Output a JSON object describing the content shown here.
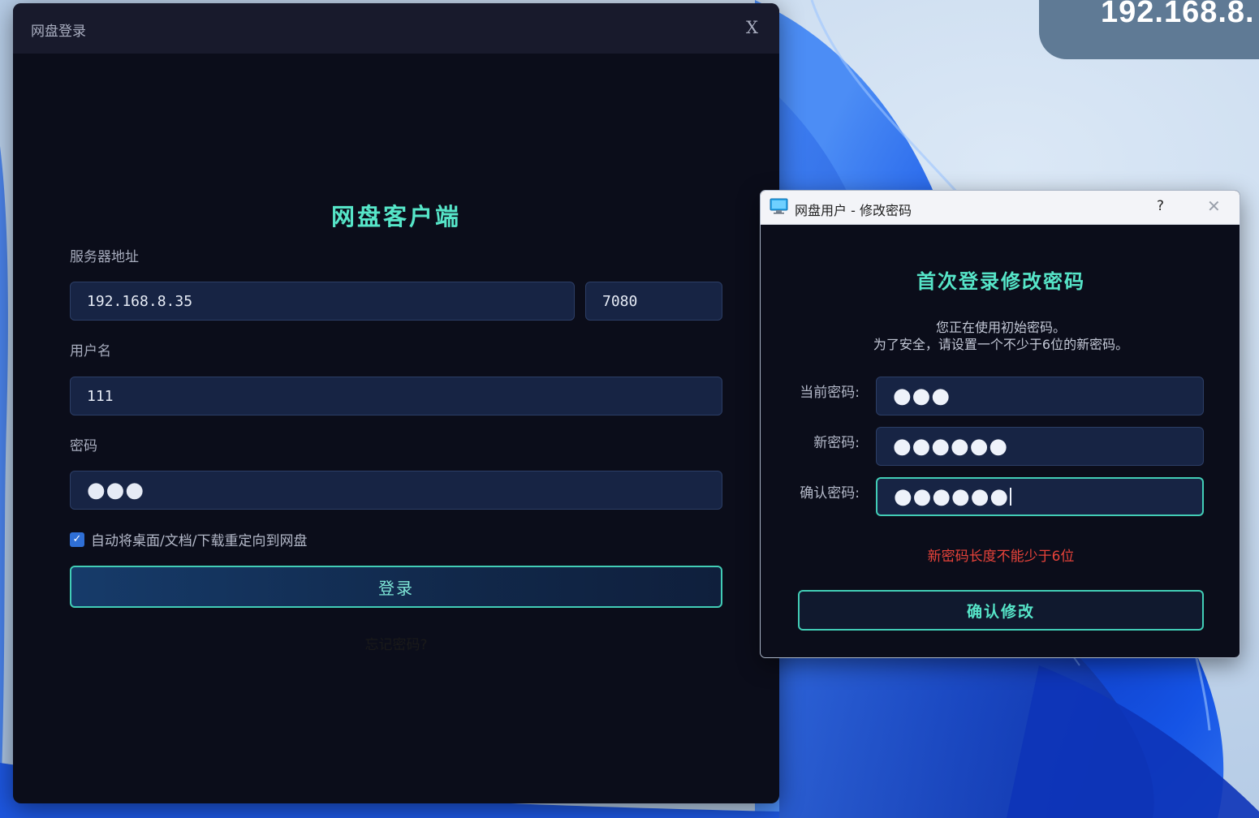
{
  "desktop": {
    "ip_badge_text": "192.168.8.",
    "accent_color": "#1b5fe3"
  },
  "login_window": {
    "title": "网盘登录",
    "close_label": "X",
    "app_title": "网盘客户端",
    "server_label": "服务器地址",
    "server_address": "192.168.8.35",
    "server_port": "7080",
    "username_label": "用户名",
    "username_value": "111",
    "password_label": "密码",
    "password_masked": "●●●",
    "redirect_checkbox": {
      "checked": true,
      "label": "自动将桌面/文档/下载重定向到网盘"
    },
    "login_button": "登录",
    "forgot_password": "忘记密码?"
  },
  "change_password_dialog": {
    "title": "网盘用户 - 修改密码",
    "help_label": "?",
    "close_label": "✕",
    "heading": "首次登录修改密码",
    "description_line1": "您正在使用初始密码。",
    "description_line2": "为了安全，请设置一个不少于6位的新密码。",
    "current_password_label": "当前密码:",
    "current_password_masked": "●●●",
    "new_password_label": "新密码:",
    "new_password_masked": "●●●●●●",
    "confirm_password_label": "确认密码:",
    "confirm_password_masked": "●●●●●●",
    "error_message": "新密码长度不能少于6位",
    "confirm_button": "确认修改",
    "error_color": "#e8433a",
    "accent_color": "#56e5c8"
  }
}
